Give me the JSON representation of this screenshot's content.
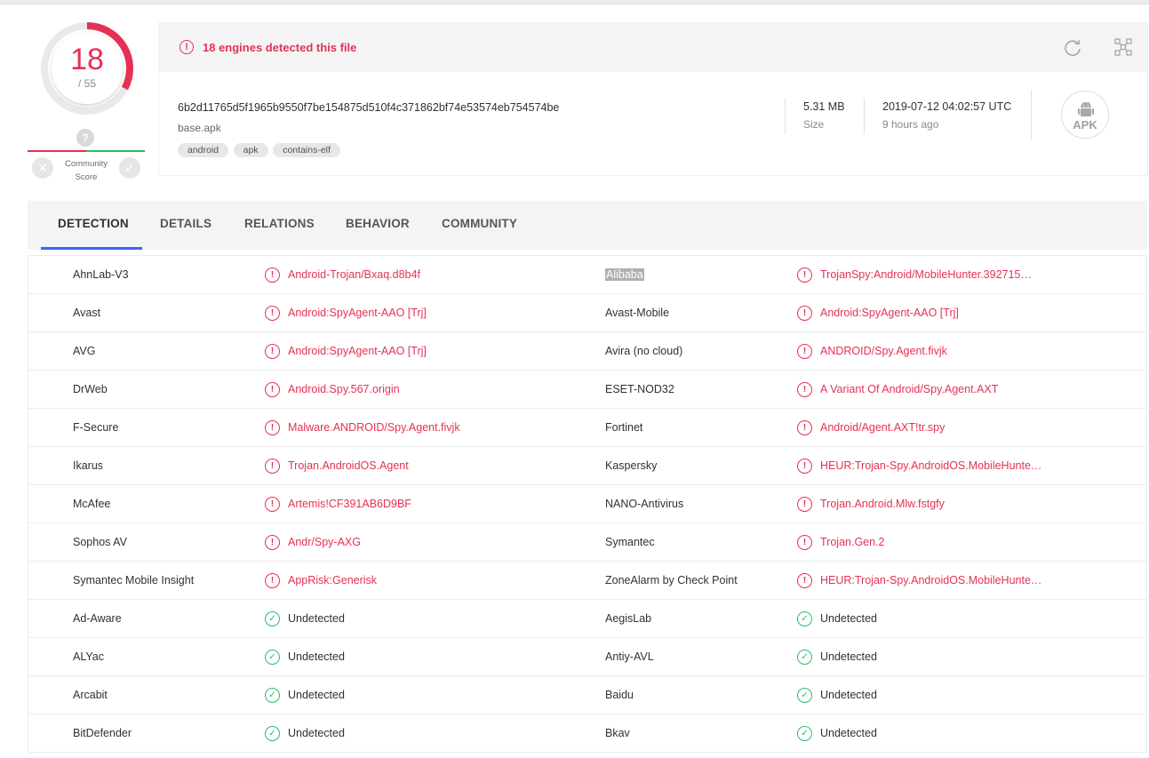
{
  "score": {
    "detected": "18",
    "total": "/ 55"
  },
  "community": {
    "question": "?",
    "label_line1": "Community",
    "label_line2": "Score"
  },
  "colors": {
    "malicious": "#e53155",
    "clean": "#2bbc6e",
    "accent": "#3b61ff"
  },
  "banner": {
    "alert_text": "18 engines detected this file"
  },
  "file": {
    "hash": "6b2d11765d5f1965b9550f7be154875d510f4c371862bf74e53574eb754574be",
    "name": "base.apk",
    "tags": [
      "android",
      "apk",
      "contains-elf"
    ],
    "size_value": "5.31 MB",
    "size_label": "Size",
    "date_value": "2019-07-12 04:02:57 UTC",
    "date_label": "9 hours ago",
    "type_icon_label": "APK"
  },
  "tabs": [
    "DETECTION",
    "DETAILS",
    "RELATIONS",
    "BEHAVIOR",
    "COMMUNITY"
  ],
  "detections": [
    {
      "left": {
        "engine": "AhnLab-V3",
        "result": "Android-Trojan/Bxaq.d8b4f",
        "status": "malicious"
      },
      "right": {
        "engine": "Alibaba",
        "result": "TrojanSpy:Android/MobileHunter.392715…",
        "status": "malicious"
      }
    },
    {
      "left": {
        "engine": "Avast",
        "result": "Android:SpyAgent-AAO [Trj]",
        "status": "malicious"
      },
      "right": {
        "engine": "Avast-Mobile",
        "result": "Android:SpyAgent-AAO [Trj]",
        "status": "malicious"
      }
    },
    {
      "left": {
        "engine": "AVG",
        "result": "Android:SpyAgent-AAO [Trj]",
        "status": "malicious"
      },
      "right": {
        "engine": "Avira (no cloud)",
        "result": "ANDROID/Spy.Agent.fivjk",
        "status": "malicious"
      }
    },
    {
      "left": {
        "engine": "DrWeb",
        "result": "Android.Spy.567.origin",
        "status": "malicious"
      },
      "right": {
        "engine": "ESET-NOD32",
        "result": "A Variant Of Android/Spy.Agent.AXT",
        "status": "malicious"
      }
    },
    {
      "left": {
        "engine": "F-Secure",
        "result": "Malware.ANDROID/Spy.Agent.fivjk",
        "status": "malicious"
      },
      "right": {
        "engine": "Fortinet",
        "result": "Android/Agent.AXT!tr.spy",
        "status": "malicious"
      }
    },
    {
      "left": {
        "engine": "Ikarus",
        "result": "Trojan.AndroidOS.Agent",
        "status": "malicious"
      },
      "right": {
        "engine": "Kaspersky",
        "result": "HEUR:Trojan-Spy.AndroidOS.MobileHunte…",
        "status": "malicious"
      }
    },
    {
      "left": {
        "engine": "McAfee",
        "result": "Artemis!CF391AB6D9BF",
        "status": "malicious"
      },
      "right": {
        "engine": "NANO-Antivirus",
        "result": "Trojan.Android.Mlw.fstgfy",
        "status": "malicious"
      }
    },
    {
      "left": {
        "engine": "Sophos AV",
        "result": "Andr/Spy-AXG",
        "status": "malicious"
      },
      "right": {
        "engine": "Symantec",
        "result": "Trojan.Gen.2",
        "status": "malicious"
      }
    },
    {
      "left": {
        "engine": "Symantec Mobile Insight",
        "result": "AppRisk:Generisk",
        "status": "malicious"
      },
      "right": {
        "engine": "ZoneAlarm by Check Point",
        "result": "HEUR:Trojan-Spy.AndroidOS.MobileHunte…",
        "status": "malicious"
      }
    },
    {
      "left": {
        "engine": "Ad-Aware",
        "result": "Undetected",
        "status": "clean"
      },
      "right": {
        "engine": "AegisLab",
        "result": "Undetected",
        "status": "clean"
      }
    },
    {
      "left": {
        "engine": "ALYac",
        "result": "Undetected",
        "status": "clean"
      },
      "right": {
        "engine": "Antiy-AVL",
        "result": "Undetected",
        "status": "clean"
      }
    },
    {
      "left": {
        "engine": "Arcabit",
        "result": "Undetected",
        "status": "clean"
      },
      "right": {
        "engine": "Baidu",
        "result": "Undetected",
        "status": "clean"
      }
    },
    {
      "left": {
        "engine": "BitDefender",
        "result": "Undetected",
        "status": "clean"
      },
      "right": {
        "engine": "Bkav",
        "result": "Undetected",
        "status": "clean"
      }
    }
  ]
}
